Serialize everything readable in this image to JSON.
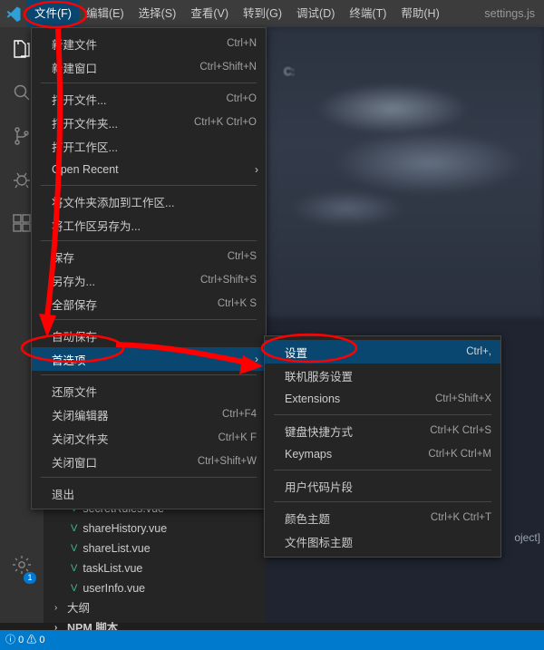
{
  "titlebar": {
    "logo_icon": "vscode-logo-icon",
    "menus": [
      {
        "label": "文件(F)",
        "active": true
      },
      {
        "label": "编辑(E)",
        "active": false
      },
      {
        "label": "选择(S)",
        "active": false
      },
      {
        "label": "查看(V)",
        "active": false
      },
      {
        "label": "转到(G)",
        "active": false
      },
      {
        "label": "调试(D)",
        "active": false
      },
      {
        "label": "终端(T)",
        "active": false
      },
      {
        "label": "帮助(H)",
        "active": false
      }
    ],
    "document_title": "settings.js"
  },
  "activitybar": {
    "items": [
      {
        "icon": "explorer-files-icon",
        "selected": true
      },
      {
        "icon": "search-icon",
        "selected": false
      },
      {
        "icon": "source-control-icon",
        "selected": false
      },
      {
        "icon": "run-debug-icon",
        "selected": false
      },
      {
        "icon": "extensions-icon",
        "selected": false
      }
    ],
    "bottom": [
      {
        "icon": "settings-gear-icon",
        "badge": "1"
      }
    ]
  },
  "file_menu": {
    "items": [
      {
        "label": "新建文件",
        "shortcut": "Ctrl+N",
        "type": "item"
      },
      {
        "label": "新建窗口",
        "shortcut": "Ctrl+Shift+N",
        "type": "item"
      },
      {
        "type": "separator"
      },
      {
        "label": "打开文件...",
        "shortcut": "Ctrl+O",
        "type": "item"
      },
      {
        "label": "打开文件夹...",
        "shortcut": "Ctrl+K Ctrl+O",
        "type": "item"
      },
      {
        "label": "打开工作区...",
        "shortcut": "",
        "type": "item"
      },
      {
        "label": "Open Recent",
        "shortcut": "",
        "type": "item",
        "submenu": "›"
      },
      {
        "type": "separator"
      },
      {
        "label": "将文件夹添加到工作区...",
        "shortcut": "",
        "type": "item"
      },
      {
        "label": "将工作区另存为...",
        "shortcut": "",
        "type": "item"
      },
      {
        "type": "separator"
      },
      {
        "label": "保存",
        "shortcut": "Ctrl+S",
        "type": "item"
      },
      {
        "label": "另存为...",
        "shortcut": "Ctrl+Shift+S",
        "type": "item"
      },
      {
        "label": "全部保存",
        "shortcut": "Ctrl+K S",
        "type": "item"
      },
      {
        "type": "separator"
      },
      {
        "label": "自动保存",
        "shortcut": "",
        "type": "item"
      },
      {
        "label": "首选项",
        "shortcut": "",
        "type": "item",
        "submenu": "›",
        "highlighted": true
      },
      {
        "type": "separator"
      },
      {
        "label": "还原文件",
        "shortcut": "",
        "type": "item"
      },
      {
        "label": "关闭编辑器",
        "shortcut": "Ctrl+F4",
        "type": "item"
      },
      {
        "label": "关闭文件夹",
        "shortcut": "Ctrl+K F",
        "type": "item"
      },
      {
        "label": "关闭窗口",
        "shortcut": "Ctrl+Shift+W",
        "type": "item"
      },
      {
        "type": "separator"
      },
      {
        "label": "退出",
        "shortcut": "",
        "type": "item"
      }
    ]
  },
  "preferences_menu": {
    "items": [
      {
        "label": "设置",
        "shortcut": "Ctrl+,",
        "type": "item",
        "highlighted": true
      },
      {
        "label": "联机服务设置",
        "shortcut": "",
        "type": "item"
      },
      {
        "label": "Extensions",
        "shortcut": "Ctrl+Shift+X",
        "type": "item"
      },
      {
        "type": "separator"
      },
      {
        "label": "键盘快捷方式",
        "shortcut": "Ctrl+K Ctrl+S",
        "type": "item"
      },
      {
        "label": "Keymaps",
        "shortcut": "Ctrl+K Ctrl+M",
        "type": "item"
      },
      {
        "type": "separator"
      },
      {
        "label": "用户代码片段",
        "shortcut": "",
        "type": "item"
      },
      {
        "type": "separator"
      },
      {
        "label": "颜色主题",
        "shortcut": "Ctrl+K Ctrl+T",
        "type": "item"
      },
      {
        "label": "文件图标主题",
        "shortcut": "",
        "type": "item"
      }
    ]
  },
  "explorer": {
    "files": [
      {
        "label": "secretRules.vue",
        "icon": "vue-file-icon"
      },
      {
        "label": "shareHistory.vue",
        "icon": "vue-file-icon"
      },
      {
        "label": "shareList.vue",
        "icon": "vue-file-icon"
      },
      {
        "label": "taskList.vue",
        "icon": "vue-file-icon"
      },
      {
        "label": "userInfo.vue",
        "icon": "vue-file-icon"
      }
    ],
    "sections": [
      {
        "label": "大纲",
        "icon": "chevron-right-icon"
      },
      {
        "label": "NPM 脚本",
        "icon": "chevron-right-icon"
      }
    ]
  },
  "editor": {
    "drive_label": "C:",
    "project_text": "oject]"
  },
  "statusbar": {
    "problems_error_count": "0",
    "problems_warning_count": "0",
    "error_icon": "error-circle-icon",
    "warning_icon": "warning-triangle-icon"
  },
  "annotations": {
    "accent_color": "#ff0000",
    "ellipses": [
      "文件(F)",
      "首选项",
      "设置"
    ],
    "arrows": 2
  }
}
